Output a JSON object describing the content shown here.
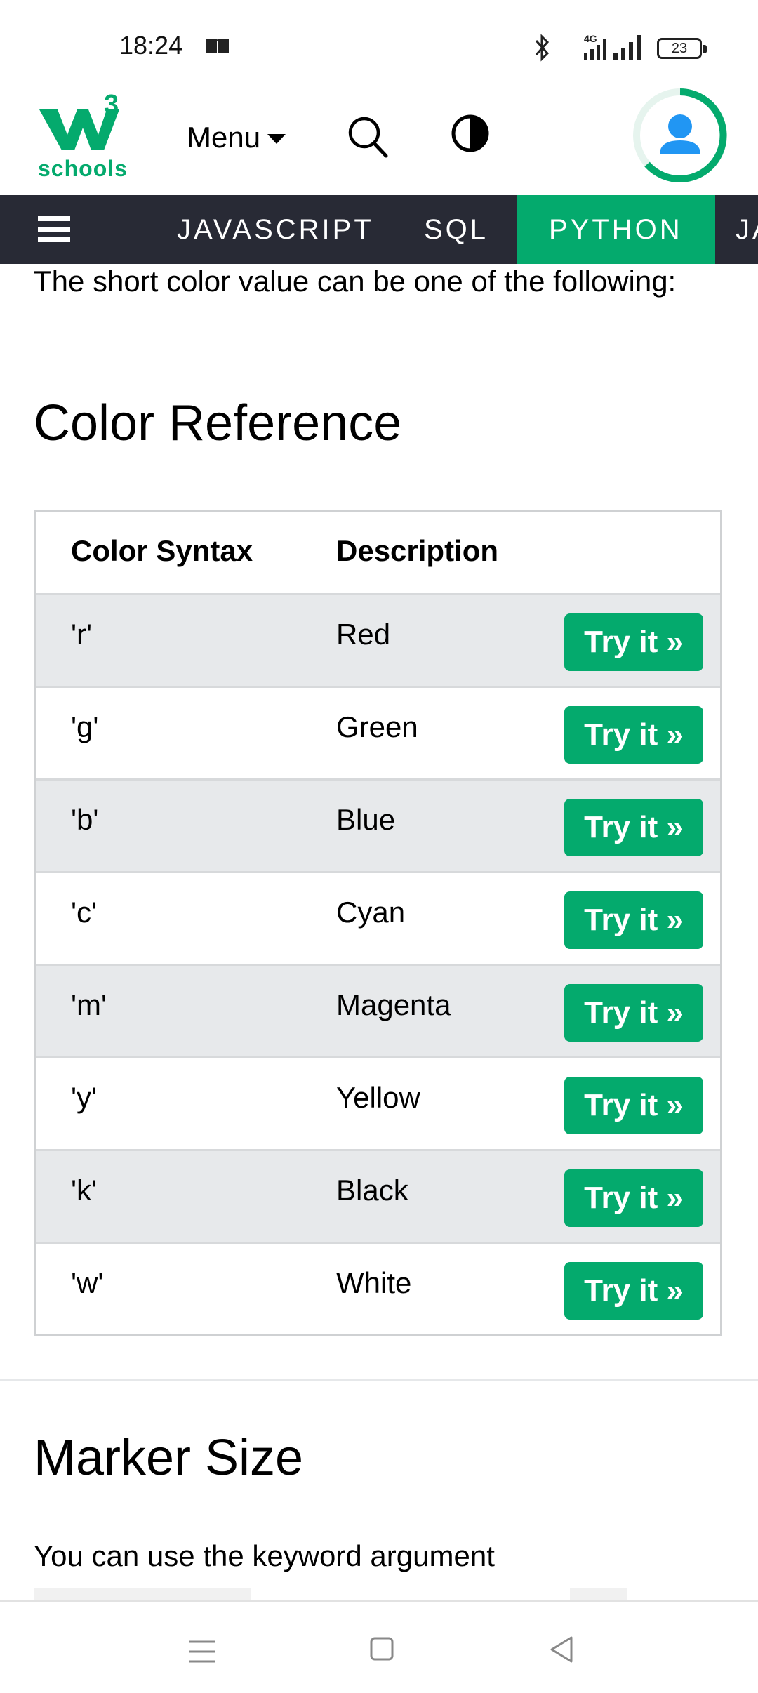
{
  "status": {
    "time": "18:24",
    "battery": "23"
  },
  "header": {
    "logo_sup": "3",
    "logo_text": "schools",
    "menu_label": "Menu"
  },
  "topnav": {
    "items": [
      "JAVASCRIPT",
      "SQL",
      "PYTHON",
      "JA"
    ],
    "active": "PYTHON"
  },
  "content": {
    "intro": "The short color value can be one of the following:",
    "color_reference_title": "Color Reference",
    "table": {
      "headers": [
        "Color Syntax",
        "Description"
      ],
      "button_label": "Try it »",
      "rows": [
        {
          "syntax": "'r'",
          "desc": "Red"
        },
        {
          "syntax": "'g'",
          "desc": "Green"
        },
        {
          "syntax": "'b'",
          "desc": "Blue"
        },
        {
          "syntax": "'c'",
          "desc": "Cyan"
        },
        {
          "syntax": "'m'",
          "desc": "Magenta"
        },
        {
          "syntax": "'y'",
          "desc": "Yellow"
        },
        {
          "syntax": "'k'",
          "desc": "Black"
        },
        {
          "syntax": "'w'",
          "desc": "White"
        }
      ]
    },
    "marker_size_title": "Marker Size",
    "marker_size_text": "You can use the keyword argument"
  },
  "colors": {
    "brand_green": "#04aa6d",
    "nav_dark": "#282a35",
    "row_gray": "#e7e9eb"
  },
  "icons": {
    "status": [
      "book-icon",
      "bluetooth-icon",
      "signal-4g-icon",
      "signal-icon",
      "battery-icon"
    ],
    "header": [
      "search-icon",
      "contrast-icon",
      "user-avatar-icon"
    ],
    "system_nav": [
      "menu-lines-icon",
      "home-square-icon",
      "back-triangle-icon"
    ]
  }
}
